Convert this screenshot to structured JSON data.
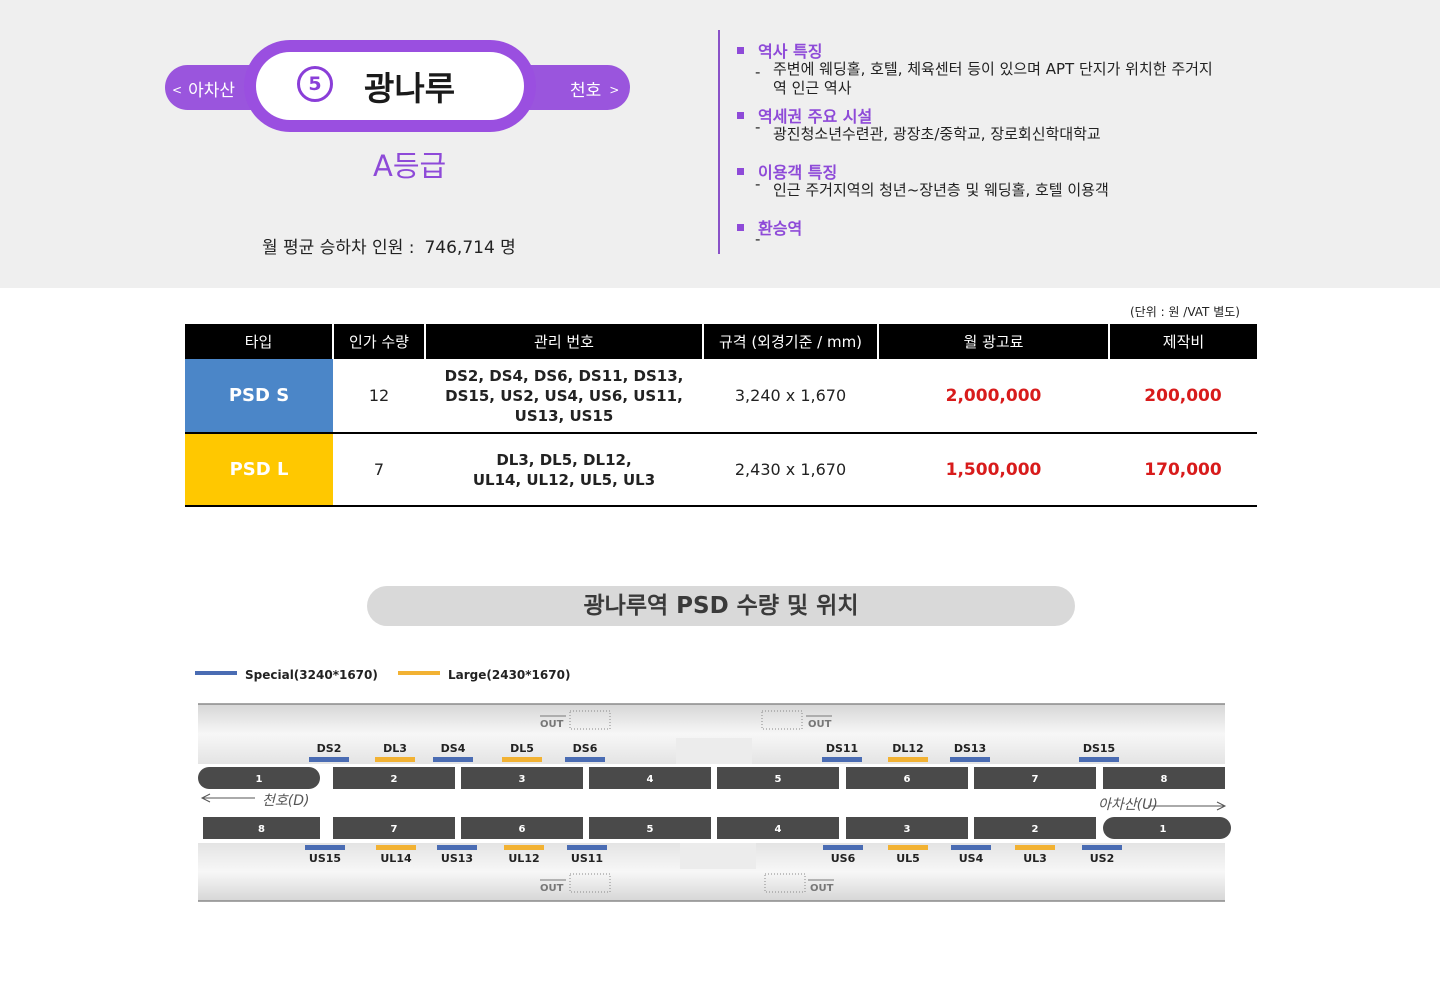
{
  "header": {
    "prev_station": "아차산",
    "next_station": "천호",
    "line_number": "5",
    "station_name": "광나루",
    "grade": "A등급",
    "riders_label": "월 평균 승하차 인원 :",
    "riders_value": "746,714 명"
  },
  "info": {
    "history_title": "역사 특징",
    "history_text_1": "주변에  웨딩홀,  호텔,  체육센터 등이  있으며  APT 단지가  위치한  주거지",
    "history_text_2": "역  인근  역사",
    "facilities_title": "역세권 주요 시설",
    "facilities_text": "광진청소년수련관, 광장초/중학교, 장로회신학대학교",
    "users_title": "이용객 특징",
    "users_text": "인근 주거지역의 청년~장년층 및 웨딩홀, 호텔 이용객",
    "transfer_title": "환승역",
    "transfer_text": "-",
    "dash": "-"
  },
  "table": {
    "unit_note": "(단위 : 원 /VAT 별도)",
    "headers": [
      "타입",
      "인가 수량",
      "관리 번호",
      "규격 (외경기준 / mm)",
      "월 광고료",
      "제작비"
    ],
    "rows": [
      {
        "type": "PSD S",
        "qty": "12",
        "codes_1": "DS2, DS4, DS6, DS11, DS13,",
        "codes_2": "DS15, US2, US4, US6, US11,",
        "codes_3": "US13, US15",
        "size": "3,240 x 1,670",
        "monthly_fee": "2,000,000",
        "production_fee": "200,000"
      },
      {
        "type": "PSD L",
        "qty": "7",
        "codes_1": "DL3, DL5, DL12,",
        "codes_2": "UL14, UL12, UL5, UL3",
        "size": "2,430 x 1,670",
        "monthly_fee": "1,500,000",
        "production_fee": "170,000"
      }
    ]
  },
  "section_title": "광나루역 PSD 수량 및 위치",
  "diagram": {
    "legend_special": "Special(3240*1670)",
    "legend_large": "Large(2430*1670)",
    "color_special": "#4a6cb3",
    "color_large": "#f2b233",
    "out_label": "OUT",
    "dir_down": "천호(D)",
    "dir_up": "아차산(U)",
    "top_platform": [
      {
        "label": "DS2",
        "kind": "special"
      },
      {
        "label": "DL3",
        "kind": "large"
      },
      {
        "label": "DS4",
        "kind": "special"
      },
      {
        "label": "DL5",
        "kind": "large"
      },
      {
        "label": "DS6",
        "kind": "special"
      },
      {
        "label": "DS11",
        "kind": "special"
      },
      {
        "label": "DL12",
        "kind": "large"
      },
      {
        "label": "DS13",
        "kind": "special"
      },
      {
        "label": "DS15",
        "kind": "special"
      }
    ],
    "bottom_platform": [
      {
        "label": "US15",
        "kind": "special"
      },
      {
        "label": "UL14",
        "kind": "large"
      },
      {
        "label": "US13",
        "kind": "special"
      },
      {
        "label": "UL12",
        "kind": "large"
      },
      {
        "label": "US11",
        "kind": "special"
      },
      {
        "label": "US6",
        "kind": "special"
      },
      {
        "label": "UL5",
        "kind": "large"
      },
      {
        "label": "US4",
        "kind": "special"
      },
      {
        "label": "UL3",
        "kind": "large"
      },
      {
        "label": "US2",
        "kind": "special"
      }
    ],
    "top_cars": [
      "1",
      "2",
      "3",
      "4",
      "5",
      "6",
      "7",
      "8"
    ],
    "bottom_cars": [
      "8",
      "7",
      "6",
      "5",
      "4",
      "3",
      "2",
      "1"
    ]
  }
}
